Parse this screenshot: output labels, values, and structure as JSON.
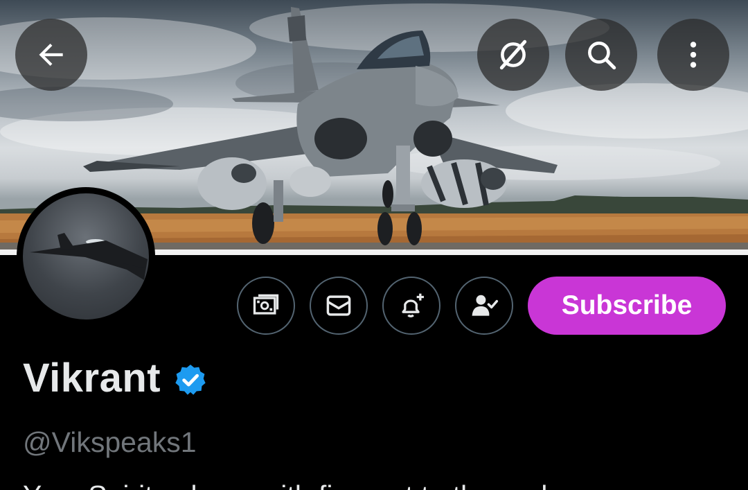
{
  "profile": {
    "display_name": "Vikrant",
    "handle": "@Vikspeaks1",
    "bio_partial": "Your Spirit echoes with fire, get to the end..."
  },
  "top_bar": {
    "back_icon": "arrow-left-icon",
    "grok_icon": "grok-slash-icon",
    "search_icon": "search-icon",
    "more_icon": "more-vertical-icon"
  },
  "actions": {
    "tip_icon": "money-icon",
    "message_icon": "envelope-icon",
    "notify_icon": "bell-plus-icon",
    "following_icon": "person-check-icon",
    "subscribe_label": "Subscribe"
  },
  "colors": {
    "subscribe": "#c936d6",
    "verified": "#1d9bf0",
    "handle": "#71767b",
    "border": "#536471",
    "background": "#000000"
  }
}
